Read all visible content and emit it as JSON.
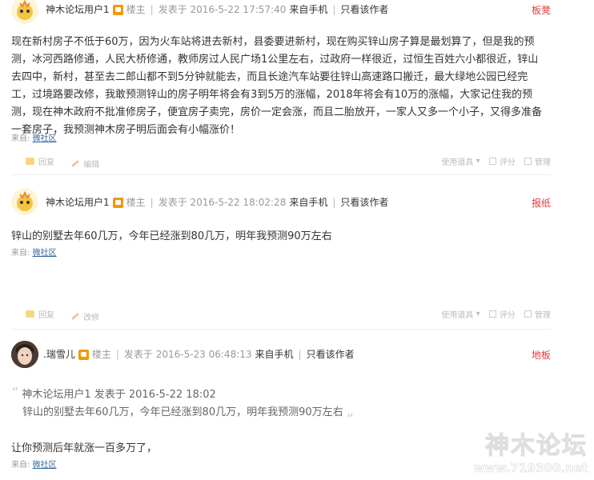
{
  "posts": [
    {
      "user": "神木论坛用户1",
      "role": "楼主",
      "posted": "发表于 2016-5-22 17:57:40",
      "device": "来自手机",
      "only_author": "只看该作者",
      "floor": "板凳",
      "lines": [
        "现在新村房子不低于60万，因为火车站将进去新村，县委要进新村，现在购买锌山房子算是最划算了，但是我的预",
        "测，冰河西路修通，人民大桥修通，教师房过人民广场1公里左右，过政府一样很近，过恒生百姓六小都很近，锌山",
        "去四中，新村，甚至去二郎山都不到5分钟就能去，而且长途汽车站要往锌山高速路口搬迁，最大绿地公园已经完",
        "工，过境路要改修，我敢预测锌山的房子明年将会有3到5万的涨幅，2018年将会有10万的涨幅，大家记住我的预",
        "测，现在神木政府不批准修房子，便宜房子卖完，房价一定会涨，而且二胎放开，一家人又多一个小子，又得多准备",
        "一套房子，我预测神木房子明后面会有小幅涨价！"
      ],
      "source_prefix": "来自:",
      "source_link": "微社区",
      "actions": {
        "reply": "回复",
        "edit": "编辑",
        "use_tool": "使用道具",
        "rate": "评分",
        "manage": "管理"
      }
    },
    {
      "user": "神木论坛用户1",
      "role": "楼主",
      "posted": "发表于 2016-5-22 18:02:28",
      "device": "来自手机",
      "only_author": "只看该作者",
      "floor": "报纸",
      "lines": [
        "锌山的别墅去年60几万，今年已经涨到80几万，明年我预测90万左右"
      ],
      "source_prefix": "来自:",
      "source_link": "微社区",
      "actions": {
        "reply": "回复",
        "edit": "改修",
        "use_tool": "使用道具",
        "rate": "评分",
        "manage": "管理"
      }
    },
    {
      "user": ".瑞雪儿",
      "role": "楼主",
      "posted": "发表于 2016-5-23 06:48:13",
      "device": "来自手机",
      "only_author": "只看该作者",
      "floor": "地板",
      "quote_header": "神木论坛用户1 发表于 2016-5-22 18:02",
      "quote_body": "锌山的别墅去年60几万，今年已经涨到80几万，明年我预测90万左右",
      "lines": [
        "让你预测后年就涨一百多万了，"
      ],
      "source_prefix": "来自:",
      "source_link": "微社区"
    }
  ],
  "watermark": {
    "name": "神木论坛",
    "url": "www.719300.net"
  },
  "colors": {
    "floor": "#e4393c",
    "badge": "#f39800",
    "link": "#336699"
  }
}
